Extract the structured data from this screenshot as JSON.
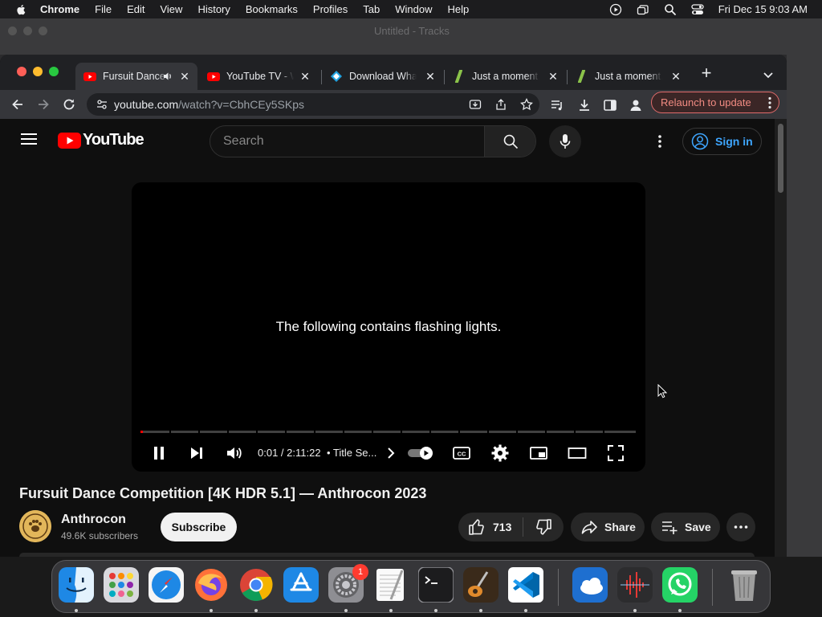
{
  "menubar": {
    "items": [
      "Chrome",
      "File",
      "Edit",
      "View",
      "History",
      "Bookmarks",
      "Profiles",
      "Tab",
      "Window",
      "Help"
    ],
    "datetime": "Fri Dec 15  9:03 AM"
  },
  "background_window": {
    "title": "Untitled - Tracks"
  },
  "browser": {
    "tabs": [
      {
        "label": "Fursuit Dance Competition",
        "active": true,
        "favicon": "youtube-icon"
      },
      {
        "label": "YouTube TV - Watch",
        "active": false,
        "favicon": "youtube-icon"
      },
      {
        "label": "Download What",
        "active": false,
        "favicon": "download-site-icon"
      },
      {
        "label": "Just a moment...",
        "active": false,
        "favicon": "green-leaf-icon"
      },
      {
        "label": "Just a moment...",
        "active": false,
        "favicon": "green-leaf-icon"
      }
    ],
    "url": {
      "host": "youtube.com",
      "path": "/watch?v=CbhCEy5SKps"
    },
    "relaunch_label": "Relaunch to update"
  },
  "youtube": {
    "logo_text": "YouTube",
    "search_placeholder": "Search",
    "signin_label": "Sign in",
    "player": {
      "warning_text": "The following contains flashing lights.",
      "time": "0:01 / 2:11:22",
      "chapter": "• Title Se...",
      "progress": 0.005
    },
    "video": {
      "title": "Fursuit Dance Competition [4K HDR 5.1] — Anthrocon 2023",
      "channel": "Anthrocon",
      "subscribers": "49.6K subscribers",
      "subscribe_label": "Subscribe",
      "likes": "713",
      "share_label": "Share",
      "save_label": "Save"
    }
  },
  "dock": {
    "apps": [
      "finder-icon",
      "launchpad-icon",
      "safari-icon",
      "firefox-icon",
      "chrome-icon",
      "app-store-icon",
      "system-settings-icon",
      "textedit-icon",
      "terminal-icon",
      "garageband-icon",
      "vscode-icon",
      "weather-icon",
      "audio-editor-icon",
      "whatsapp-icon",
      "trash-icon"
    ],
    "settings_badge": "1"
  },
  "colors": {
    "youtube_red": "#ff0000",
    "link_blue": "#3ea6ff",
    "relaunch": "#f28b82"
  }
}
